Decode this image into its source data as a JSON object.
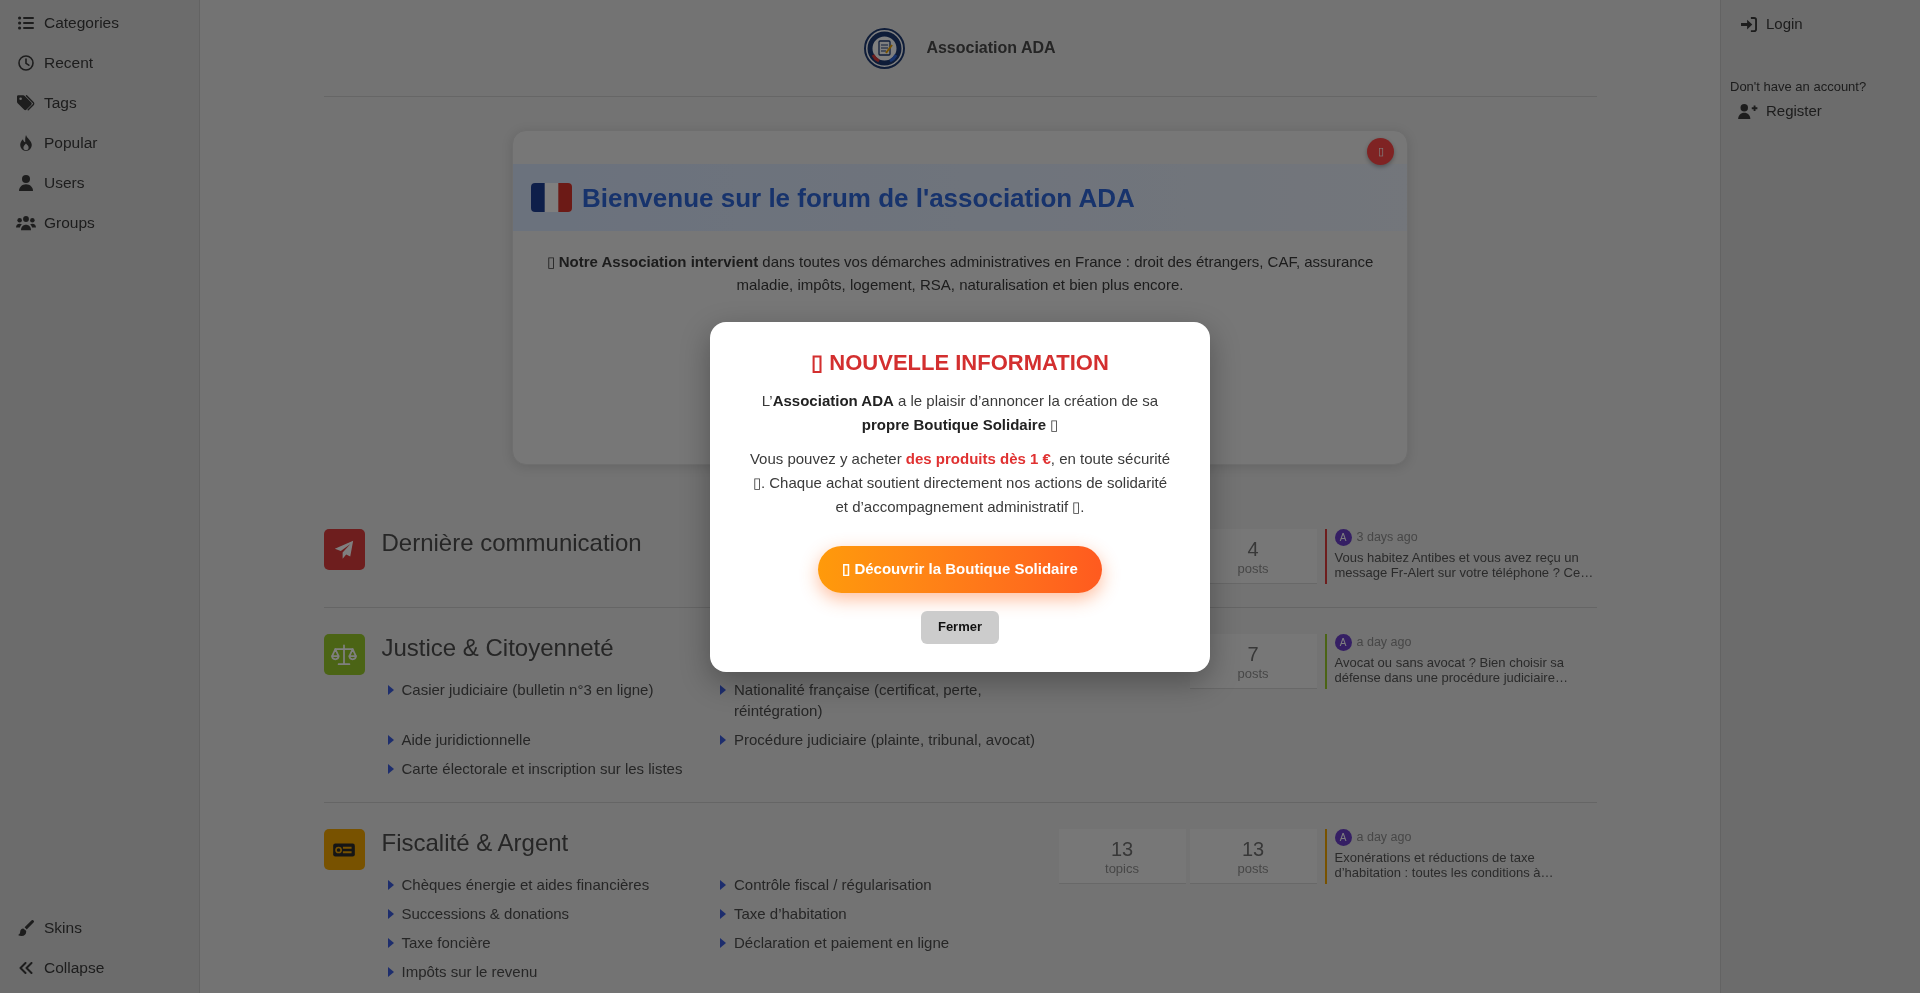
{
  "sidebar": {
    "items": [
      {
        "label": "Categories"
      },
      {
        "label": "Recent"
      },
      {
        "label": "Tags"
      },
      {
        "label": "Popular"
      },
      {
        "label": "Users"
      },
      {
        "label": "Groups"
      }
    ],
    "bottom_items": [
      {
        "label": "Skins"
      },
      {
        "label": "Collapse"
      }
    ]
  },
  "header": {
    "title": "Association ADA"
  },
  "account": {
    "login": "Login",
    "register_prompt": "Don't have an account?",
    "register": "Register"
  },
  "welcome_card": {
    "close_button": "▯",
    "title": "Bienvenue sur le forum de l'association ADA",
    "text": "▯ **Notre Association intervient** dans toutes vos démarches administratives en France : droit des étrangers, CAF, assurance maladie, impôts, logement, RSA, naturalisation et bien plus encore."
  },
  "categories": [
    {
      "title": "Dernière communication",
      "color": "#6e1e1e",
      "posts": {
        "value": "4",
        "label": "posts"
      },
      "last_post": {
        "avatar": "A",
        "time": "3 days ago",
        "excerpt": "Vous habitez Antibes et vous avez reçu un message Fr-Alert sur votre téléphone ? Ce…"
      }
    },
    {
      "title": "Justice & Citoyenneté",
      "color": "#4b6415",
      "subcategories": [
        "Casier judiciaire (bulletin n°3 en ligne)",
        "Nationalité française (certificat, perte, réintégration)",
        "Aide juridictionnelle",
        "Procédure judiciaire (plainte, tribunal, avocat)",
        "Carte électorale et inscription sur les listes"
      ],
      "posts": {
        "value": "7",
        "label": "posts"
      },
      "last_post": {
        "avatar": "A",
        "time": "a day ago",
        "excerpt": "Avocat ou sans avocat ? Bien choisir sa défense dans une procédure judiciaire…"
      }
    },
    {
      "title": "Fiscalité & Argent",
      "color": "#785200",
      "subcategories": [
        "Chèques énergie et aides financières",
        "Contrôle fiscal / régularisation",
        "Successions & donations",
        "Taxe d’habitation",
        "Taxe foncière",
        "Déclaration et paiement en ligne",
        "Impôts sur le revenu"
      ],
      "topics": {
        "value": "13",
        "label": "topics"
      },
      "posts": {
        "value": "13",
        "label": "posts"
      },
      "last_post": {
        "avatar": "A",
        "time": "a day ago",
        "excerpt": "Exonérations et réductions de taxe d’habitation : toutes les conditions à…"
      }
    }
  ],
  "modal": {
    "title": "▯ NOUVELLE INFORMATION",
    "paragraphs": [
      {
        "kind": "plain",
        "text": "L’**Association ADA** a le plaisir d’annoncer la création de sa **propre Boutique Solidaire** ▯"
      },
      {
        "kind": "highlight",
        "text": "Vous pouvez y acheter **des produits dès 1 €**, en toute sécurité ▯. Chaque achat soutient directement nos actions de solidarité et d’accompagnement administratif ▯."
      }
    ],
    "primary_button": "▯ Découvrir la Boutique Solidaire",
    "close_button": "Fermer"
  }
}
